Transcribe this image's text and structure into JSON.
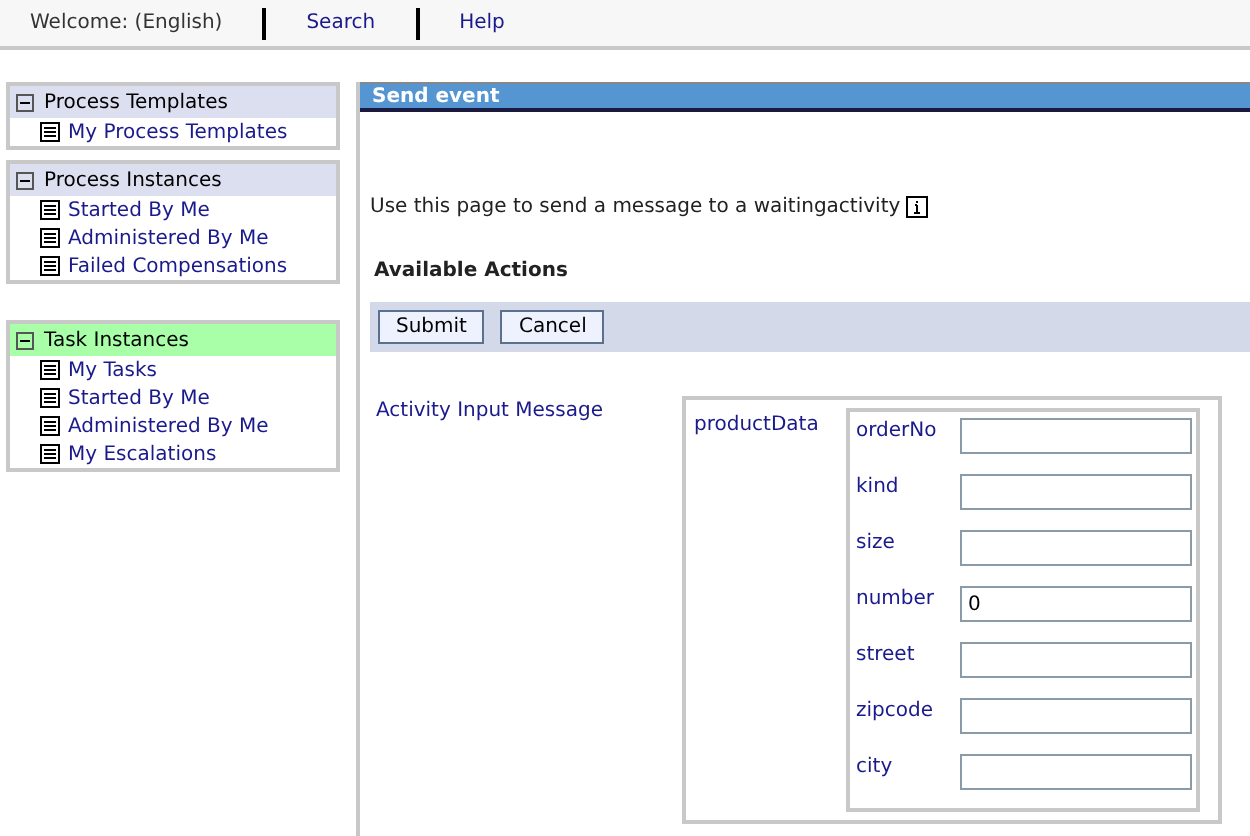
{
  "top_nav": [
    {
      "kind": "text",
      "label": "Welcome: (English)"
    },
    {
      "kind": "link",
      "label": "Search"
    },
    {
      "kind": "link",
      "label": "Help"
    }
  ],
  "sidebar": [
    {
      "title": "Process Templates",
      "expanded": true,
      "selected": false,
      "items": [
        "My Process Templates"
      ]
    },
    {
      "title": "Process Instances",
      "expanded": true,
      "selected": false,
      "items": [
        "Started By Me",
        "Administered By Me",
        "Failed Compensations"
      ]
    },
    {
      "title": "Task Instances",
      "expanded": true,
      "selected": true,
      "items": [
        "My Tasks",
        "Started By Me",
        "Administered By Me",
        "My Escalations"
      ]
    }
  ],
  "panel": {
    "title": "Send event",
    "description": "Use this page to send a message to a waitingactivity",
    "actions_heading": "Available Actions",
    "buttons": [
      "Submit",
      "Cancel"
    ],
    "message_label": "Activity Input Message",
    "group_label": "productData",
    "fields": [
      {
        "label": "orderNo"
      },
      {
        "label": "kind"
      },
      {
        "label": "size"
      },
      {
        "label": "number",
        "value": "0"
      },
      {
        "label": "street"
      },
      {
        "label": "zipcode"
      },
      {
        "label": "city"
      }
    ]
  }
}
